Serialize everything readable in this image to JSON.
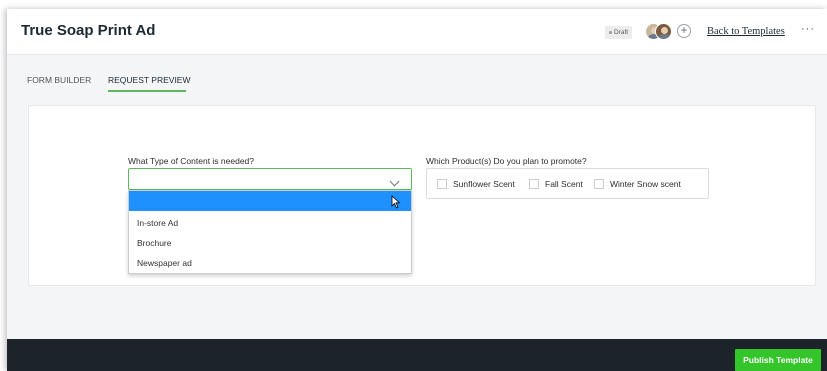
{
  "header": {
    "title": "True Soap Print Ad",
    "status_badge": "Draft",
    "add_collaborator_symbol": "+",
    "back_link": "Back to Templates",
    "more_menu": "···"
  },
  "tabs": [
    {
      "label": "FORM BUILDER",
      "active": false
    },
    {
      "label": "REQUEST PREVIEW",
      "active": true
    }
  ],
  "form": {
    "content_type": {
      "label": "What Type of Content is needed?",
      "value": "",
      "options": [
        "In-store Ad",
        "Brochure",
        "Newspaper ad"
      ]
    },
    "products": {
      "label": "Which Product(s) Do you plan to promote?",
      "options": [
        {
          "label": "Sunflower Scent",
          "checked": false
        },
        {
          "label": "Fall Scent",
          "checked": false
        },
        {
          "label": "Winter Snow scent",
          "checked": false
        }
      ]
    }
  },
  "footer": {
    "publish_label": "Publish Template"
  },
  "colors": {
    "accent_green": "#5cb85c",
    "publish_green": "#34c52a",
    "highlight_blue": "#1e90ff",
    "footer_dark": "#1d2429"
  },
  "icons": [
    "chevron-down-icon",
    "plus-icon",
    "more-icon",
    "cursor-icon"
  ]
}
